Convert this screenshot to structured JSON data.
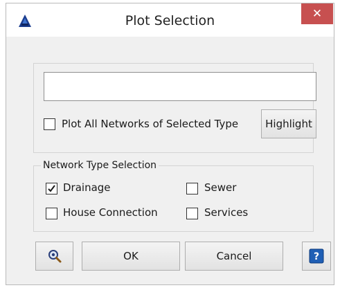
{
  "window": {
    "title": "Plot Selection",
    "close_glyph": "✕"
  },
  "selection": {
    "input_value": "",
    "plot_all_label": "Plot All Networks of Selected Type",
    "plot_all_checked": false,
    "highlight_label": "Highlight"
  },
  "network_type": {
    "legend": "Network Type Selection",
    "options": [
      {
        "label": "Drainage",
        "checked": true
      },
      {
        "label": "Sewer",
        "checked": false
      },
      {
        "label": "House Connection",
        "checked": false
      },
      {
        "label": "Services",
        "checked": false
      }
    ]
  },
  "buttons": {
    "ok_label": "OK",
    "cancel_label": "Cancel",
    "zoom_icon": "magnifier-icon",
    "help_icon": "help-icon"
  },
  "colors": {
    "close_bg": "#c75050",
    "help_blue": "#1f5fb5",
    "app_icon": "#1b3d8f"
  }
}
